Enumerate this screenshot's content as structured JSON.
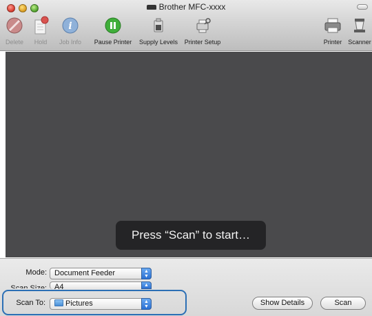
{
  "window": {
    "title": "Brother MFC-xxxx"
  },
  "toolbar": {
    "items": [
      {
        "label": "Delete",
        "icon": "delete-icon",
        "enabled": false
      },
      {
        "label": "Hold",
        "icon": "hold-icon",
        "enabled": false
      },
      {
        "label": "Job Info",
        "icon": "info-icon",
        "enabled": false
      },
      {
        "label": "Pause Printer",
        "icon": "pause-icon",
        "enabled": true
      },
      {
        "label": "Supply Levels",
        "icon": "supply-levels-icon",
        "enabled": true
      },
      {
        "label": "Printer Setup",
        "icon": "printer-setup-icon",
        "enabled": true
      },
      {
        "label": "Printer",
        "icon": "printer-icon",
        "enabled": true
      },
      {
        "label": "Scanner",
        "icon": "scanner-icon",
        "enabled": true
      }
    ]
  },
  "main": {
    "hud_message": "Press “Scan” to start…"
  },
  "controls": {
    "mode_label": "Mode:",
    "mode_value": "Document Feeder",
    "scan_size_label": "Scan Size:",
    "scan_size_value": "A4",
    "scan_to_label": "Scan To:",
    "scan_to_value": "Pictures",
    "show_details_label": "Show Details",
    "scan_label": "Scan"
  },
  "colors": {
    "content_background": "#4a4a4c",
    "hud_background": "#242426",
    "highlight_border": "#2b6fb5",
    "accent_blue": "#2a6fd3"
  }
}
